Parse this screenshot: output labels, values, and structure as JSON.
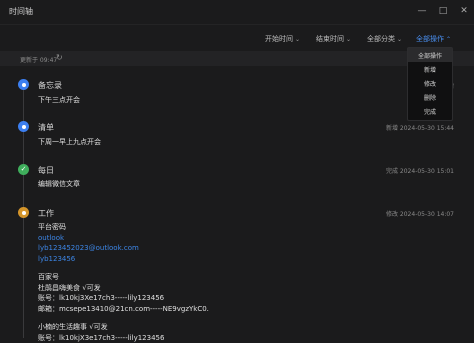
{
  "window": {
    "title": "时间轴",
    "minimize_glyph": "—",
    "maximize_glyph": "□",
    "close_glyph": "✕"
  },
  "filters": [
    {
      "label": "开始时间"
    },
    {
      "label": "结束时间"
    },
    {
      "label": "全部分类"
    },
    {
      "label": "全部操作"
    }
  ],
  "refresh": {
    "text": "更新于 09:47",
    "icon": "refresh-icon"
  },
  "dropdown": {
    "items": [
      "全部操作",
      "新增",
      "修改",
      "删除",
      "完成"
    ]
  },
  "entries": [
    {
      "category": "备忘录",
      "action": "新增",
      "time": "",
      "content": [
        "下午三点开会"
      ],
      "color": "#3c7ff0",
      "icon": "circle-dot-icon"
    },
    {
      "category": "清单",
      "action": "新增",
      "time": "2024-05-30 15:44",
      "content": [
        "下周一早上九点开会"
      ],
      "color": "#3c7ff0",
      "icon": "circle-dot-icon"
    },
    {
      "category": "每日",
      "action": "完成",
      "time": "2024-05-30 15:01",
      "content": [
        "编辑微信文章"
      ],
      "color": "#3fae5c",
      "icon": "check-icon"
    },
    {
      "category": "工作",
      "action": "修改",
      "time": "2024-05-30 14:07",
      "color": "#d4952a",
      "icon": "circle-dot-icon",
      "content": [
        "平台密码",
        "outlook",
        "lyb123452023@outlook.com",
        "lyb123456",
        "",
        "百家号",
        "杜鹃昌嗨美食   √可发",
        "账号：lk10kj3Xe17ch3-----lily123456",
        "邮箱：mcsepe13410@21cn.com-----NE9vgzYkC0.",
        "",
        "小楠的生活趣事   √可发",
        "账号：lk10kjX3e17ch3-----lily123456"
      ]
    }
  ]
}
